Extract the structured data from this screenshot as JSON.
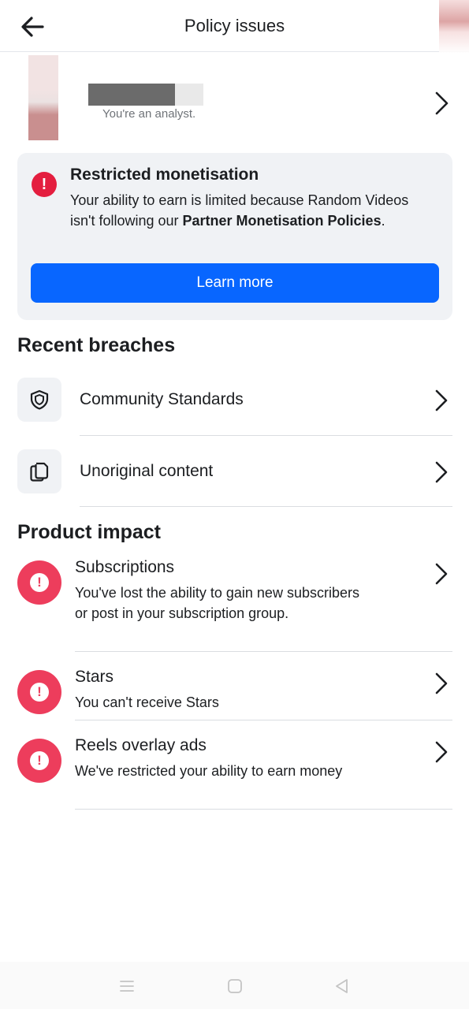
{
  "header": {
    "title": "Policy issues",
    "back_icon": "arrow-left-icon"
  },
  "profile": {
    "subtitle": "You're an analyst.",
    "chevron_icon": "chevron-right-icon"
  },
  "alert": {
    "icon": "exclamation-circle-icon",
    "title": "Restricted monetisation",
    "body_prefix": "Your ability to earn is limited because Random Videos isn't following our ",
    "body_bold": "Partner Monetisation Policies",
    "body_suffix": ".",
    "button_label": "Learn more",
    "colors": {
      "icon": "#e41e3f",
      "button": "#0866ff",
      "card": "#f0f2f5"
    }
  },
  "recent_breaches": {
    "title": "Recent breaches",
    "items": [
      {
        "label": "Community Standards",
        "icon": "shield-icon"
      },
      {
        "label": "Unoriginal content",
        "icon": "copy-pages-icon"
      }
    ]
  },
  "product_impact": {
    "title": "Product impact",
    "items": [
      {
        "title": "Subscriptions",
        "description": "You've lost the ability to gain new subscribers or post in your subscription group.",
        "icon": "exclamation-circle-icon"
      },
      {
        "title": "Stars",
        "description": "You can't receive Stars",
        "icon": "exclamation-circle-icon"
      },
      {
        "title": "Reels overlay ads",
        "description": "We've restricted your ability to earn money",
        "icon": "exclamation-circle-icon"
      }
    ],
    "colors": {
      "icon": "#ed3d5c"
    }
  },
  "navbar": {
    "items": [
      "menu-icon",
      "home-square-icon",
      "back-triangle-icon"
    ]
  }
}
